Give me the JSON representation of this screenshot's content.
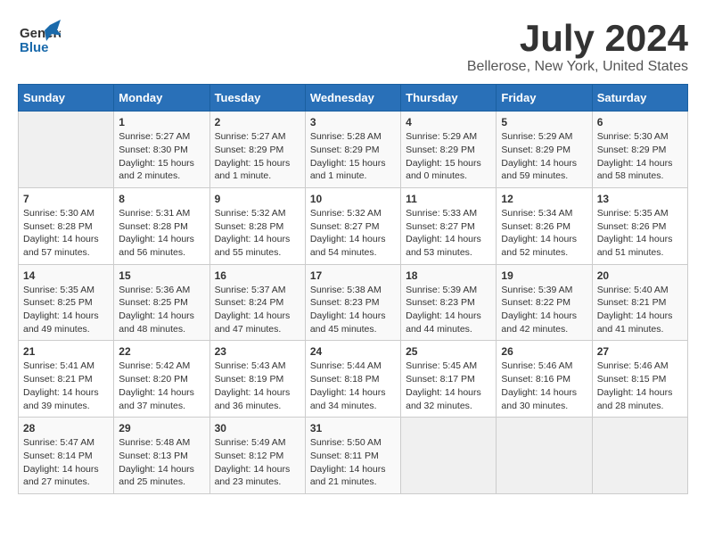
{
  "header": {
    "logo_general": "General",
    "logo_blue": "Blue",
    "month_year": "July 2024",
    "location": "Bellerose, New York, United States"
  },
  "days_of_week": [
    "Sunday",
    "Monday",
    "Tuesday",
    "Wednesday",
    "Thursday",
    "Friday",
    "Saturday"
  ],
  "weeks": [
    [
      {
        "day": "",
        "info": ""
      },
      {
        "day": "1",
        "info": "Sunrise: 5:27 AM\nSunset: 8:30 PM\nDaylight: 15 hours\nand 2 minutes."
      },
      {
        "day": "2",
        "info": "Sunrise: 5:27 AM\nSunset: 8:29 PM\nDaylight: 15 hours\nand 1 minute."
      },
      {
        "day": "3",
        "info": "Sunrise: 5:28 AM\nSunset: 8:29 PM\nDaylight: 15 hours\nand 1 minute."
      },
      {
        "day": "4",
        "info": "Sunrise: 5:29 AM\nSunset: 8:29 PM\nDaylight: 15 hours\nand 0 minutes."
      },
      {
        "day": "5",
        "info": "Sunrise: 5:29 AM\nSunset: 8:29 PM\nDaylight: 14 hours\nand 59 minutes."
      },
      {
        "day": "6",
        "info": "Sunrise: 5:30 AM\nSunset: 8:29 PM\nDaylight: 14 hours\nand 58 minutes."
      }
    ],
    [
      {
        "day": "7",
        "info": "Sunrise: 5:30 AM\nSunset: 8:28 PM\nDaylight: 14 hours\nand 57 minutes."
      },
      {
        "day": "8",
        "info": "Sunrise: 5:31 AM\nSunset: 8:28 PM\nDaylight: 14 hours\nand 56 minutes."
      },
      {
        "day": "9",
        "info": "Sunrise: 5:32 AM\nSunset: 8:28 PM\nDaylight: 14 hours\nand 55 minutes."
      },
      {
        "day": "10",
        "info": "Sunrise: 5:32 AM\nSunset: 8:27 PM\nDaylight: 14 hours\nand 54 minutes."
      },
      {
        "day": "11",
        "info": "Sunrise: 5:33 AM\nSunset: 8:27 PM\nDaylight: 14 hours\nand 53 minutes."
      },
      {
        "day": "12",
        "info": "Sunrise: 5:34 AM\nSunset: 8:26 PM\nDaylight: 14 hours\nand 52 minutes."
      },
      {
        "day": "13",
        "info": "Sunrise: 5:35 AM\nSunset: 8:26 PM\nDaylight: 14 hours\nand 51 minutes."
      }
    ],
    [
      {
        "day": "14",
        "info": "Sunrise: 5:35 AM\nSunset: 8:25 PM\nDaylight: 14 hours\nand 49 minutes."
      },
      {
        "day": "15",
        "info": "Sunrise: 5:36 AM\nSunset: 8:25 PM\nDaylight: 14 hours\nand 48 minutes."
      },
      {
        "day": "16",
        "info": "Sunrise: 5:37 AM\nSunset: 8:24 PM\nDaylight: 14 hours\nand 47 minutes."
      },
      {
        "day": "17",
        "info": "Sunrise: 5:38 AM\nSunset: 8:23 PM\nDaylight: 14 hours\nand 45 minutes."
      },
      {
        "day": "18",
        "info": "Sunrise: 5:39 AM\nSunset: 8:23 PM\nDaylight: 14 hours\nand 44 minutes."
      },
      {
        "day": "19",
        "info": "Sunrise: 5:39 AM\nSunset: 8:22 PM\nDaylight: 14 hours\nand 42 minutes."
      },
      {
        "day": "20",
        "info": "Sunrise: 5:40 AM\nSunset: 8:21 PM\nDaylight: 14 hours\nand 41 minutes."
      }
    ],
    [
      {
        "day": "21",
        "info": "Sunrise: 5:41 AM\nSunset: 8:21 PM\nDaylight: 14 hours\nand 39 minutes."
      },
      {
        "day": "22",
        "info": "Sunrise: 5:42 AM\nSunset: 8:20 PM\nDaylight: 14 hours\nand 37 minutes."
      },
      {
        "day": "23",
        "info": "Sunrise: 5:43 AM\nSunset: 8:19 PM\nDaylight: 14 hours\nand 36 minutes."
      },
      {
        "day": "24",
        "info": "Sunrise: 5:44 AM\nSunset: 8:18 PM\nDaylight: 14 hours\nand 34 minutes."
      },
      {
        "day": "25",
        "info": "Sunrise: 5:45 AM\nSunset: 8:17 PM\nDaylight: 14 hours\nand 32 minutes."
      },
      {
        "day": "26",
        "info": "Sunrise: 5:46 AM\nSunset: 8:16 PM\nDaylight: 14 hours\nand 30 minutes."
      },
      {
        "day": "27",
        "info": "Sunrise: 5:46 AM\nSunset: 8:15 PM\nDaylight: 14 hours\nand 28 minutes."
      }
    ],
    [
      {
        "day": "28",
        "info": "Sunrise: 5:47 AM\nSunset: 8:14 PM\nDaylight: 14 hours\nand 27 minutes."
      },
      {
        "day": "29",
        "info": "Sunrise: 5:48 AM\nSunset: 8:13 PM\nDaylight: 14 hours\nand 25 minutes."
      },
      {
        "day": "30",
        "info": "Sunrise: 5:49 AM\nSunset: 8:12 PM\nDaylight: 14 hours\nand 23 minutes."
      },
      {
        "day": "31",
        "info": "Sunrise: 5:50 AM\nSunset: 8:11 PM\nDaylight: 14 hours\nand 21 minutes."
      },
      {
        "day": "",
        "info": ""
      },
      {
        "day": "",
        "info": ""
      },
      {
        "day": "",
        "info": ""
      }
    ]
  ]
}
